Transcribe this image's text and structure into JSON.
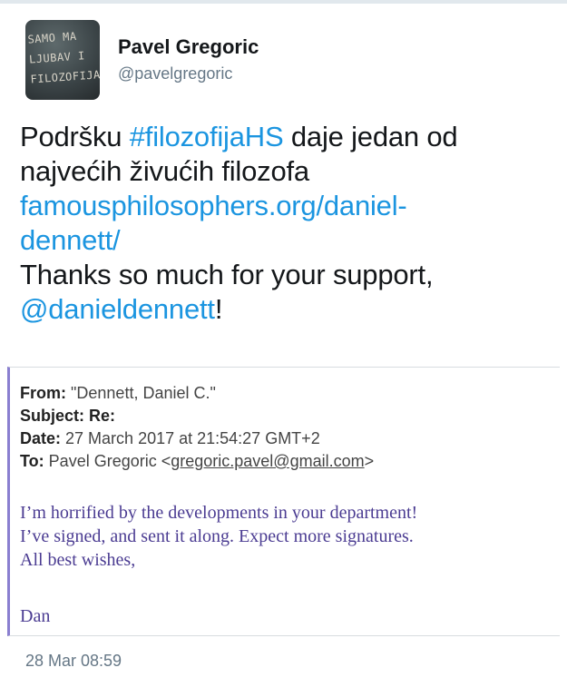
{
  "profile": {
    "display_name": "Pavel Gregoric",
    "handle": "@pavelgregoric",
    "avatar_text": [
      "SAMO MA",
      "LJUBAV I",
      "FILOZOFIJA"
    ]
  },
  "tweet": {
    "line1_a": "Podršku ",
    "hashtag": "#filozofijaHS",
    "line1_b": " daje jedan od",
    "line2": "najvećih živućih filozofa",
    "link_part1": "famousphilosophers.org/daniel-",
    "link_part2": "dennett/",
    "line5": "Thanks so much for your support,",
    "mention": "@danieldennett",
    "mention_suffix": "!",
    "timestamp": "28 Mar 08:59"
  },
  "email": {
    "from_label": "From:",
    "from_value": "\"Dennett, Daniel C.\"",
    "subject_label": "Subject:",
    "subject_value": "Re:",
    "date_label": "Date:",
    "date_value": "27 March 2017 at 21:54:27 GMT+2",
    "to_label": "To:",
    "to_name": "Pavel Gregoric <",
    "to_address": "gregoric.pavel@gmail.com",
    "to_close": ">",
    "body_lines": [
      "I’m horrified by the developments in your department!",
      "I’ve signed, and sent it along. Expect more signatures.",
      "All best wishes,"
    ],
    "signoff": "Dan"
  },
  "colors": {
    "link": "#1b95e0",
    "email_body": "#4b3c92",
    "email_rule": "#8a7fd0",
    "muted": "#657786"
  }
}
